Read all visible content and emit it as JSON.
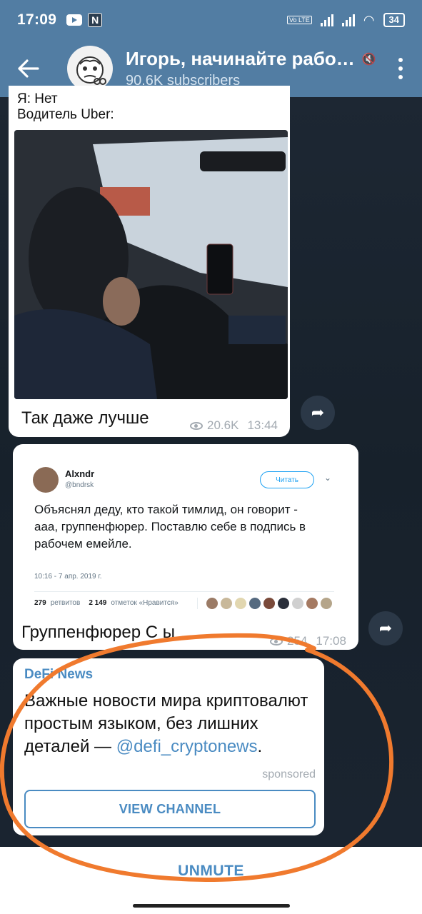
{
  "status_bar": {
    "time": "17:09",
    "battery": "34",
    "volte": "Vo LTE"
  },
  "header": {
    "title": "Игорь, начинайте рабо…",
    "subscribers": "90.6K subscribers"
  },
  "messages": [
    {
      "top_text_1": "Я: Нет",
      "top_text_2": "Водитель Uber:",
      "caption": "Так даже лучше",
      "views": "20.6K",
      "time": "13:44"
    },
    {
      "tweet": {
        "author": "Alxndr",
        "handle": "@bndrsk",
        "follow_label": "Читать",
        "text": "Объяснял деду, кто такой тимлид, он говорит - ааа, группенфюрер. Поставлю себе в подпись в рабочем емейле.",
        "date": "10:16 - 7 апр. 2019 г.",
        "retweets": "279",
        "retweets_label": "ретвитов",
        "likes": "2 149",
        "likes_label": "отметок «Нравится»"
      },
      "caption": "Группенфюрер С ы",
      "views": "254",
      "time": "17:08"
    }
  ],
  "sponsored_message": {
    "channel": "DeFi News",
    "text": "Важные новости мира криптовалют простым языком, без лишних деталей — ",
    "link": "@defi_cryptonews",
    "text_end": ".",
    "sponsored_label": "sponsored",
    "button_label": "VIEW CHANNEL"
  },
  "bottom_bar": {
    "action_label": "UNMUTE"
  },
  "colors": {
    "header_bg": "#527da3",
    "accent": "#4a8bc2",
    "annotation": "#f07a2e"
  }
}
